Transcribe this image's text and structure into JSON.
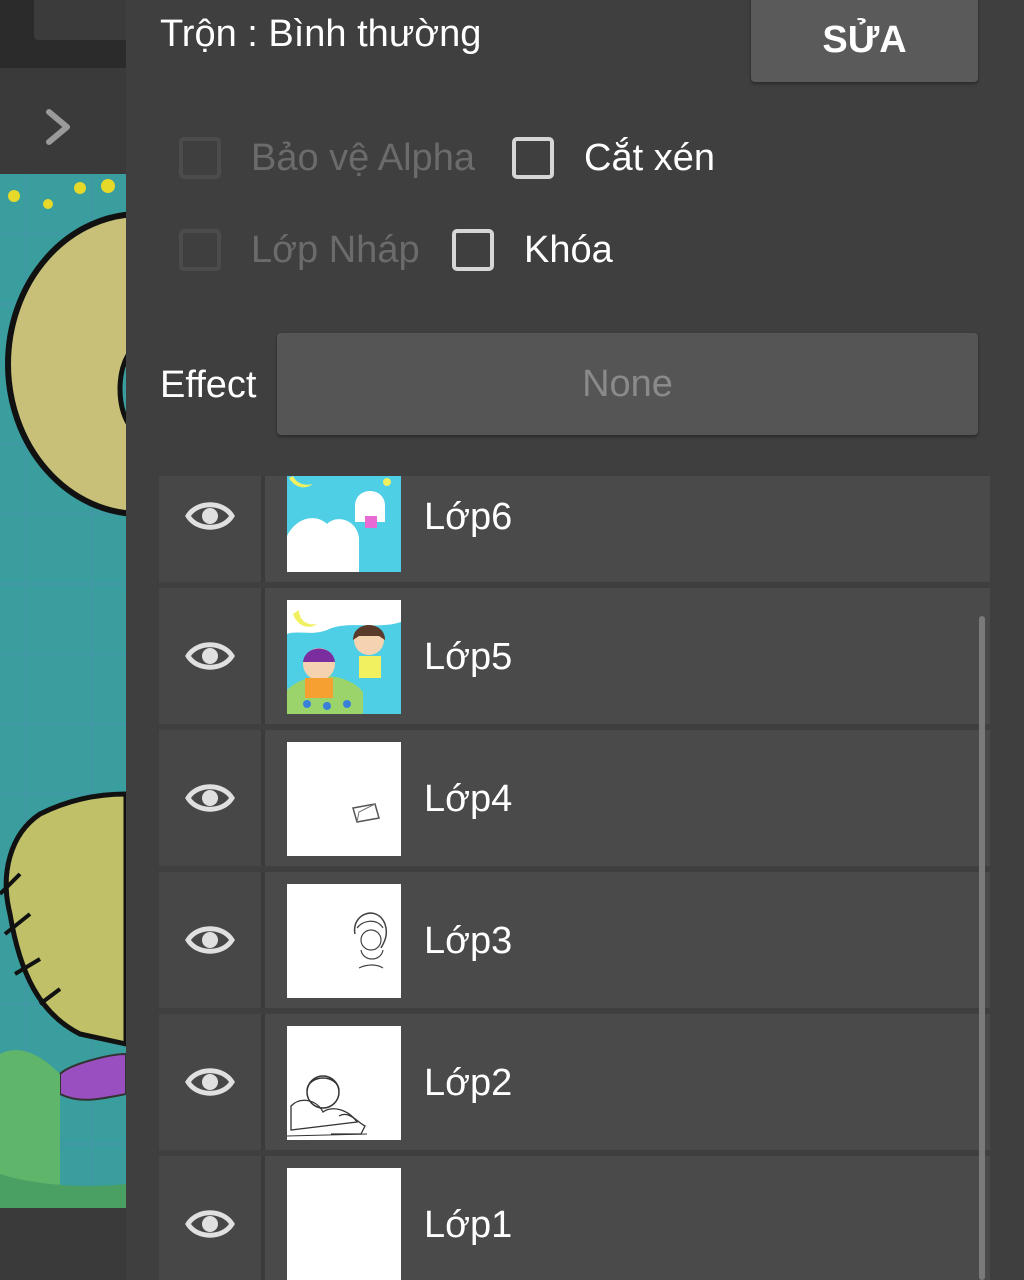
{
  "layer_settings": {
    "blend_label": "Trộn : Bình thường",
    "edit_button": "SỬA",
    "options": {
      "alpha_protect": {
        "label": "Bảo vệ Alpha",
        "checked": false,
        "enabled": false
      },
      "clipping": {
        "label": "Cắt xén",
        "checked": false,
        "enabled": true
      },
      "draft_layer": {
        "label": "Lớp Nháp",
        "checked": false,
        "enabled": false
      },
      "lock": {
        "label": "Khóa",
        "checked": false,
        "enabled": true
      }
    },
    "effect_label": "Effect",
    "effect_value": "None"
  },
  "layers": [
    {
      "name": "Lớp6",
      "visible": true,
      "thumbnail": "sky-clouds-moon-art"
    },
    {
      "name": "Lớp5",
      "visible": true,
      "thumbnail": "colored-characters-art"
    },
    {
      "name": "Lớp4",
      "visible": true,
      "thumbnail": "small-sketch-object"
    },
    {
      "name": "Lớp3",
      "visible": true,
      "thumbnail": "character-lineart-sketch"
    },
    {
      "name": "Lớp2",
      "visible": true,
      "thumbnail": "characters-lineart"
    },
    {
      "name": "Lớp1",
      "visible": true,
      "thumbnail": "blank-white"
    }
  ],
  "icons": {
    "visibility": "eye-icon",
    "expand": "chevron-right-icon"
  },
  "colors": {
    "panel_bg": "#3f3f3f",
    "row_bg": "#4a4a4a",
    "button_bg": "#5a5a5a",
    "canvas_teal": "#3a9e9e"
  }
}
